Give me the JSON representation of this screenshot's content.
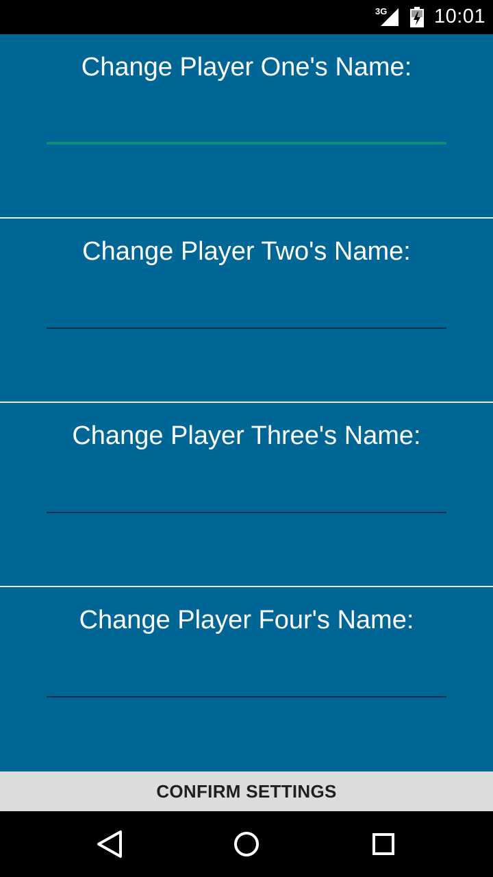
{
  "status_bar": {
    "network": "3G",
    "time": "10:01"
  },
  "sections": [
    {
      "label": "Change Player One's Name:",
      "value": "",
      "focused": true
    },
    {
      "label": "Change Player Two's Name:",
      "value": "",
      "focused": false
    },
    {
      "label": "Change Player Three's Name:",
      "value": "",
      "focused": false
    },
    {
      "label": "Change Player Four's Name:",
      "value": "",
      "focused": false
    }
  ],
  "confirm_button": {
    "label": "CONFIRM SETTINGS"
  },
  "nav_bar": {
    "icons": [
      "back-icon",
      "home-icon",
      "recents-icon"
    ]
  },
  "colors": {
    "background": "#006696",
    "focus_underline": "#0f8f7a",
    "button": "#dcdcdc"
  }
}
